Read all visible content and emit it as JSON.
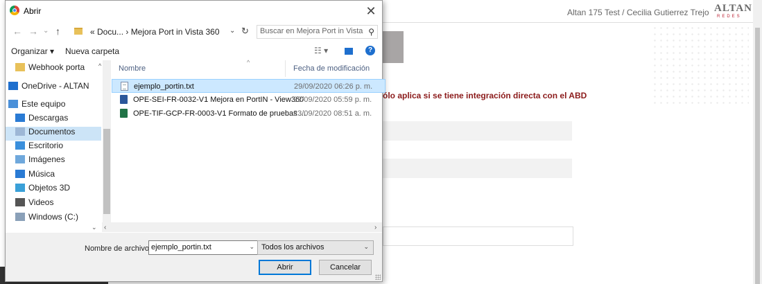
{
  "background_page": {
    "user_text": "Altan 175 Test / Cecilia Gutierrez Trejo",
    "logo_text": "ALTAN",
    "logo_subtext": "REDES",
    "warning_text": "ólo aplica si se tiene integración directa con el ABD"
  },
  "dialog": {
    "title": "Abrir",
    "close_glyph": "✕"
  },
  "navigation": {
    "back_glyph": "←",
    "forward_glyph": "→",
    "recent_glyph": "⌄",
    "up_glyph": "↑",
    "address": "« Docu...  ›  Mejora Port in Vista 360",
    "refresh_glyph": "↻",
    "search_placeholder": "Buscar en Mejora Port in Vista ..."
  },
  "toolbar": {
    "organize_label": "Organizar ▾",
    "new_folder_label": "Nueva carpeta",
    "help_glyph": "?"
  },
  "tree": {
    "items": [
      {
        "label": "Webhook porta",
        "icon": "folder-icon",
        "color": "#e8c15a"
      },
      {
        "label": "OneDrive - ALTAN",
        "icon": "cloud-icon",
        "color": "#1e6fce"
      },
      {
        "label": "Este equipo",
        "icon": "computer-icon",
        "color": "#4a90d9"
      },
      {
        "label": "Descargas",
        "icon": "download-icon",
        "color": "#2a7bd4"
      },
      {
        "label": "Documentos",
        "icon": "documents-icon",
        "color": "#9db7d6"
      },
      {
        "label": "Escritorio",
        "icon": "desktop-icon",
        "color": "#3a8fdc"
      },
      {
        "label": "Imágenes",
        "icon": "pictures-icon",
        "color": "#6fa8dc"
      },
      {
        "label": "Música",
        "icon": "music-icon",
        "color": "#2a7bd4"
      },
      {
        "label": "Objetos 3D",
        "icon": "3d-objects-icon",
        "color": "#3aa0d8"
      },
      {
        "label": "Videos",
        "icon": "videos-icon",
        "color": "#555555"
      },
      {
        "label": "Windows (C:)",
        "icon": "drive-icon",
        "color": "#8aa0b8"
      }
    ]
  },
  "filelist": {
    "columns": {
      "name": "Nombre",
      "modified": "Fecha de modificación"
    },
    "files": [
      {
        "name": "ejemplo_portin.txt",
        "date": "29/09/2020 06:26 p. m.",
        "type": "txt"
      },
      {
        "name": "OPE-SEI-FR-0032-V1 Mejora en PortIN - View360",
        "date": "22/09/2020 05:59 p. m.",
        "type": "word"
      },
      {
        "name": "OPE-TIF-GCP-FR-0003-V1 Formato de pruebas ...",
        "date": "23/09/2020 08:51 a. m.",
        "type": "excel"
      }
    ]
  },
  "footer": {
    "filename_label": "Nombre de archivo:",
    "filename_value": "ejemplo_portin.txt",
    "filter_value": "Todos los archivos",
    "open_label": "Abrir",
    "cancel_label": "Cancelar"
  }
}
